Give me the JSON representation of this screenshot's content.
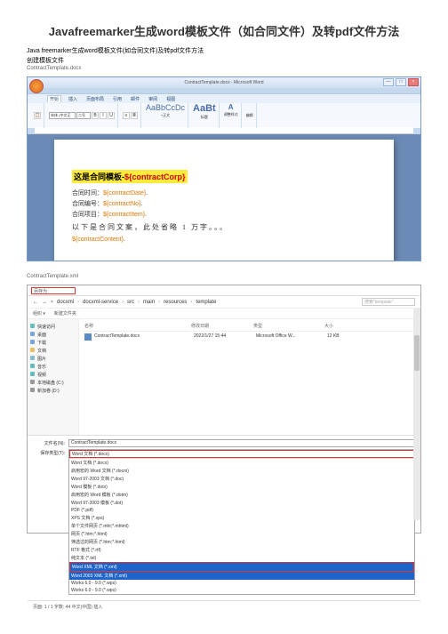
{
  "title": "Javafreemarker生成word模板文件（如合同文件）及转pdf文件方法",
  "sub1": "Java freemarker生成word模板文件(如合同文件)及转pdf文件方法",
  "sub2": "创建模板文件",
  "file1": "ContractTemplate.docx",
  "word": {
    "titlebar": "ContractTemplate.docx - Microsoft Word",
    "tabs": [
      "开始",
      "插入",
      "页面布局",
      "引用",
      "邮件",
      "审阅",
      "视图"
    ],
    "font": "宋体 (中文正",
    "size": "二号",
    "styleA": "AaBbCcDc",
    "styleB": "AaBt",
    "styleLbls": [
      "+正文",
      "标题"
    ],
    "menu1": "调整样式",
    "menu2": "编辑",
    "yellow_left": "这是合同模板-",
    "yellow_right": "${contractCorp}",
    "line1_l": "合同时间：",
    "line1_r": "${contractDate}",
    "line2_l": "合同编号：",
    "line2_r": "${contractNo}",
    "line3_l": "合同项目：",
    "line3_r": "${contractItem}",
    "big": "以下是合同文案，此处省略 1 万字。。。",
    "content": "${contractContent}"
  },
  "file2": "ContractTemplate.xml",
  "save": {
    "legend": "另存为",
    "path": [
      "docxml",
      "docxml-service",
      "src",
      "main",
      "resources",
      "template"
    ],
    "search_ph": "搜索\"template\"",
    "org": "组织 ▾",
    "newf": "新建文件夹",
    "side": {
      "quick": "快速访问",
      "desktop": "桌面",
      "download": "下载",
      "docs": "文档",
      "imgs": "图片",
      "music": "音乐",
      "videos": "视频",
      "local": "本地磁盘 (C:)",
      "net": "新加卷 (D:)"
    },
    "hdr": {
      "name": "名称",
      "date": "修改日期",
      "type": "类型",
      "size": "大小"
    },
    "row": {
      "name": "ContractTemplate.docx",
      "date": "2022/1/27 15:44",
      "type": "Microsoft Office W...",
      "size": "12 KB"
    },
    "fn_label": "文件名(N):",
    "fn_value": "ContractTemplate.docx",
    "ft_label": "保存类型(T):",
    "ft_value": "Word 文档 (*.docx)",
    "types": [
      "Word 文档 (*.docx)",
      "启用宏的 Word 文档 (*.docm)",
      "Word 97-2003 文档 (*.doc)",
      "Word 模板 (*.dotx)",
      "启用宏的 Word 模板 (*.dotm)",
      "Word 97-2003 模板 (*.dot)",
      "PDF (*.pdf)",
      "XPS 文档 (*.xps)",
      "单个文件网页 (*.mht;*.mhtml)",
      "网页 (*.htm;*.html)",
      "筛选过的网页 (*.htm;*.html)",
      "RTF 格式 (*.rtf)",
      "纯文本 (*.txt)",
      "Word XML 文档 (*.xml)",
      "Word 2003 XML 文档 (*.xml)",
      "Works 6.0 - 9.0 (*.wps)",
      "Works 6.0 - 9.0 (*.wps)"
    ],
    "foot": "页面: 1 / 1    字数: 44    中文(中国)    插入"
  }
}
